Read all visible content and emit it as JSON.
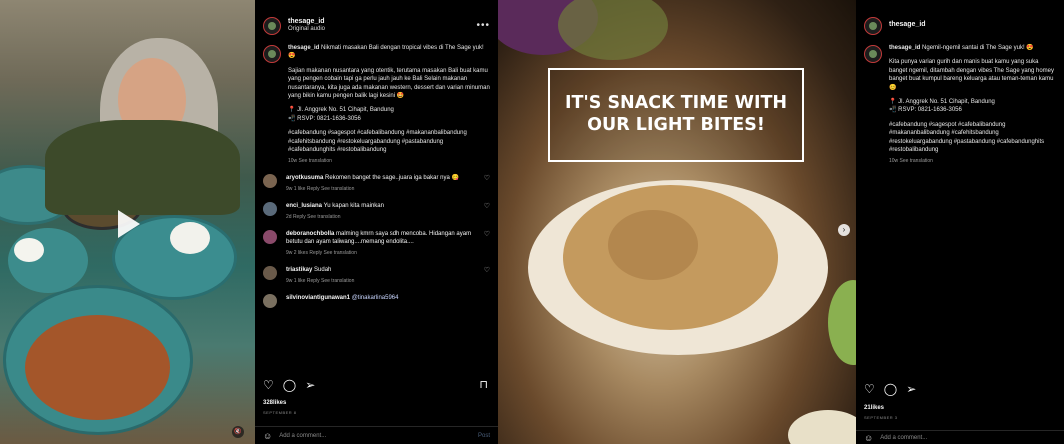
{
  "post1": {
    "username": "thesage_id",
    "audio": "Original audio",
    "caption_user": "thesage_id",
    "caption_lead": "Nikmati masakan Bali dengan tropical vibes di The Sage yuk! 😍",
    "caption_body": "Sajian makanan nusantara yang otentik, terutama masakan Bali buat kamu yang pengen cobain tapi ga perlu jauh jauh ke Bali Selain makanan nusantaranya, kita juga ada makanan western, dessert dan varian minuman yang bikin kamu pengen balik lagi kesini 🤩",
    "address": "📍 Jl. Anggrek No. 51 Cihapit, Bandung",
    "rsvp": "📲 RSVP: 0821-1636-3056",
    "hashtags": "#cafebandung #sagespot #cafebalibandung #makananbalibandung #cafehitsbandung #restokeluargabandung #pastabandung #cafebandunghits #restobalibandung",
    "caption_meta": "10w   See translation",
    "comments": [
      {
        "user": "aryotkusuma",
        "text": "Rekomen banget the sage..juara iga bakar nya 😋",
        "meta": "9w   1 like   Reply   See translation"
      },
      {
        "user": "enci_lusiana",
        "text": "Yu kapan kita mainkan",
        "meta": "2d   Reply   See translation"
      },
      {
        "user": "deboranochbolla",
        "text": "malming kmrn saya sdh mencoba. Hidangan ayam betutu dan ayam taliwang....memang endolita....",
        "meta": "9w   2 likes   Reply   See translation"
      },
      {
        "user": "triastikay",
        "text": "Sudah",
        "meta": "9w   1 like   Reply   See translation"
      },
      {
        "user": "silvinoviantigunawan1",
        "text": "@tinakarlina5964",
        "meta": ""
      }
    ],
    "likes": "328likes",
    "date": "SEPTEMBER 8",
    "add_comment": "Add a comment...",
    "post_label": "Post"
  },
  "post2": {
    "username": "thesage_id",
    "caption_user": "thesage_id",
    "caption_lead": "Ngemil-ngemil santai di The Sage yuk! 😍",
    "caption_body": "Kita punya varian gurih dan manis buat kamu yang suka banget ngemil, ditambah dengan vibes The Sage yang homey banget buat kumpul bareng keluarga atau teman-teman kamu 😊",
    "address": "📍 Jl. Anggrek No. 51 Cihapit, Bandung",
    "rsvp": "📲 RSVP: 0821-1636-3056",
    "hashtags": "#cafebandung #sagespot #cafebalibandung #makananbalibandung #cafehitsbandung #restokeluargabandung #pastabandung #cafebandunghits #restobalibandung",
    "caption_meta": "10w   See translation",
    "likes": "21likes",
    "date": "SEPTEMBER 3",
    "add_comment": "Add a comment..."
  },
  "image2": {
    "overlay_text": "IT'S SNACK TIME WITH OUR LIGHT BITES!"
  },
  "icons": {
    "heart": "heart-icon",
    "comment": "comment-icon",
    "share": "share-icon",
    "bookmark": "bookmark-icon",
    "more": "more-icon",
    "play": "play-icon",
    "next": "chevron-right-icon",
    "mute": "mute-icon",
    "emoji": "emoji-icon"
  }
}
